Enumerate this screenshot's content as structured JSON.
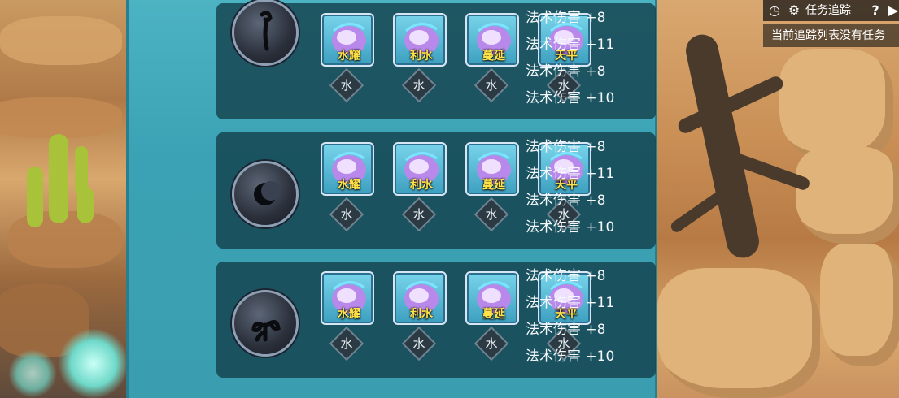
{
  "hud": {
    "quest_tracking_label": "任务追踪",
    "help_label": "?",
    "empty_message": "当前追踪列表没有任务"
  },
  "rows": [
    {
      "emblem": "hook-symbol-icon",
      "gems": [
        {
          "name": "水耀",
          "element": "水"
        },
        {
          "name": "利水",
          "element": "水"
        },
        {
          "name": "蔓延",
          "element": "水"
        },
        {
          "name": "天平",
          "element": "水"
        }
      ],
      "stats": [
        "法术伤害 +8",
        "法术伤害 +11",
        "法术伤害 +8",
        "法术伤害 +10"
      ]
    },
    {
      "emblem": "crescent-moon-icon",
      "gems": [
        {
          "name": "水耀",
          "element": "水"
        },
        {
          "name": "利水",
          "element": "水"
        },
        {
          "name": "蔓延",
          "element": "水"
        },
        {
          "name": "天平",
          "element": "水"
        }
      ],
      "stats": [
        "法术伤害 +8",
        "法术伤害 +11",
        "法术伤害 +8",
        "法术伤害 +10"
      ]
    },
    {
      "emblem": "curl-sprout-icon",
      "gems": [
        {
          "name": "水耀",
          "element": "水"
        },
        {
          "name": "利水",
          "element": "水"
        },
        {
          "name": "蔓延",
          "element": "水"
        },
        {
          "name": "天平",
          "element": "水"
        }
      ],
      "stats": [
        "法术伤害 +8",
        "法术伤害 +11",
        "法术伤害 +8",
        "法术伤害 +10"
      ]
    }
  ],
  "colors": {
    "panel": "#3aa2b4",
    "row_bg": "#123c48",
    "gem_label": "#ffe24a"
  }
}
